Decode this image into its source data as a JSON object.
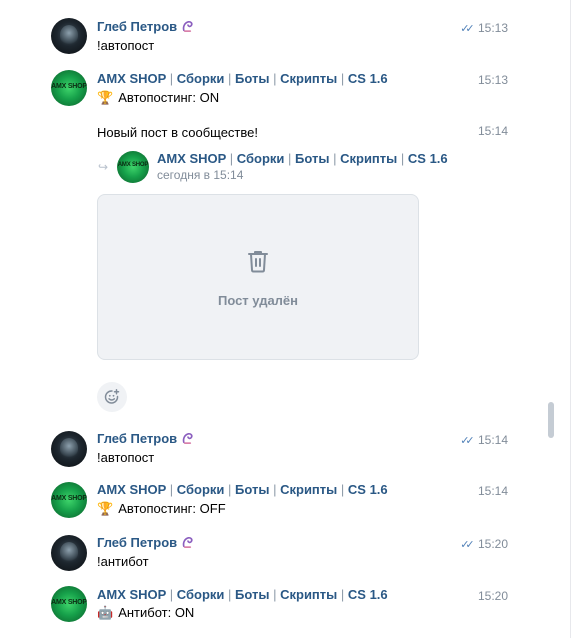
{
  "messages": [
    {
      "author": "Глеб Петров",
      "text": "!автопост",
      "time": "15:13",
      "read": true
    },
    {
      "author_parts": [
        "AMX SHOP",
        "Сборки",
        "Боты",
        "Скрипты",
        "CS 1.6"
      ],
      "text": "Автопостинг: ON",
      "emoji": "🏆",
      "time": "15:13"
    },
    {
      "text": "Новый пост в сообществе!",
      "time": "15:14"
    },
    {
      "author": "Глеб Петров",
      "text": "!автопост",
      "time": "15:14",
      "read": true
    },
    {
      "author_parts": [
        "AMX SHOP",
        "Сборки",
        "Боты",
        "Скрипты",
        "CS 1.6"
      ],
      "text": "Автопостинг: OFF",
      "emoji": "🏆",
      "time": "15:14"
    },
    {
      "author": "Глеб Петров",
      "text": "!антибот",
      "time": "15:20",
      "read": true
    },
    {
      "author_parts": [
        "AMX SHOP",
        "Сборки",
        "Боты",
        "Скрипты",
        "CS 1.6"
      ],
      "text": "Антибот: ON",
      "emoji": "🤖",
      "time": "15:20"
    }
  ],
  "repost": {
    "author_parts": [
      "AMX SHOP",
      "Сборки",
      "Боты",
      "Скрипты",
      "CS 1.6"
    ],
    "date": "сегодня в 15:14",
    "deleted_label": "Пост удалён"
  },
  "avatar_labels": {
    "amx": "AMX SHOP"
  },
  "colors": {
    "link": "#2a5885",
    "muted": "#818c99",
    "check": "#5181b8",
    "card_bg": "#f0f2f5"
  }
}
